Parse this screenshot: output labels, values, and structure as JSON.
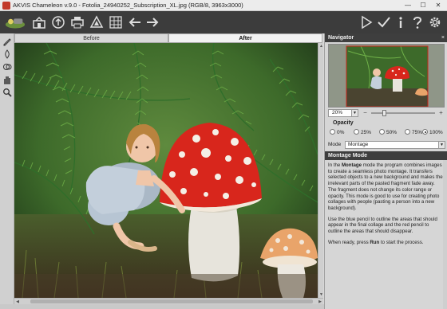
{
  "window": {
    "title": "AKVIS Chameleon v.9.0 - Fotolia_24940252_Subscription_XL.jpg (RGB/8, 3963x3000)",
    "min": "—",
    "max": "☐",
    "close": "✕"
  },
  "toolbar": {
    "left_icons": [
      "home-icon",
      "open-image-icon",
      "upload-icon",
      "print-icon",
      "triangle-icon",
      "collage-grid-icon",
      "back-arrow-icon",
      "forward-arrow-icon"
    ],
    "right_icons": [
      "run-icon",
      "apply-icon",
      "info-icon",
      "help-icon",
      "settings-icon"
    ]
  },
  "tabs": {
    "before": "Before",
    "after": "After"
  },
  "tools": [
    "blue-pencil-icon",
    "red-pencil-icon",
    "chameleon-icon",
    "hand-icon",
    "zoom-icon"
  ],
  "navigator": {
    "title": "Navigator",
    "close": "×",
    "zoom_value": "20%",
    "zoom_minus": "−",
    "zoom_plus": "+",
    "zoom_level": 0.2
  },
  "opacity": {
    "label": "Opacity",
    "options": [
      "0%",
      "25%",
      "50%",
      "75%",
      "100%"
    ],
    "selected": "100%"
  },
  "mode": {
    "label": "Mode",
    "value": "Montage"
  },
  "help": {
    "title": "Montage Mode",
    "p1_a": "In the ",
    "p1_b": "Montage",
    "p1_c": " mode the program combines images to create a seamless photo montage. It transfers selected objects to a new background and makes the irrelevant parts of the pasted fragment fade away. The fragment does not change its color range or opacity. This mode is good to use for creating photo collages with people (pasting a person into a new background).",
    "p2": "Use the blue pencil to outline the areas that should appear in the final collage and the red pencil to outline the areas that should disappear.",
    "p3_a": "When ready, press ",
    "p3_b": "Run",
    "p3_c": " to start the process."
  },
  "colors": {
    "toolbar_bg": "#3c3c3c",
    "panel_head_bg": "#3e3e3e",
    "mushroom_red": "#d8261c",
    "grass_green": "#3f7a2a"
  }
}
